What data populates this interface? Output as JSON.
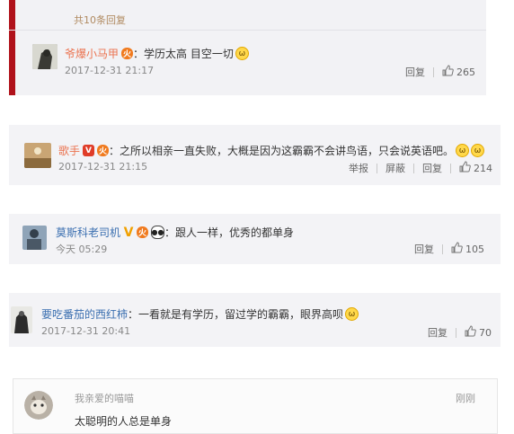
{
  "comments": [
    {
      "header": "共10条回复",
      "name": "爷爆小马甲",
      "text": "：学历太高 目空一切",
      "time": "2017-12-31 21:17",
      "reply": "回复",
      "likes": "265"
    },
    {
      "name": "歌手",
      "text": "：之所以相亲一直失败，大概是因为这霸霸不会讲鸟语，只会说英语吧。",
      "time": "2017-12-31 21:15",
      "report": "举报",
      "block": "屏蔽",
      "reply": "回复",
      "likes": "214"
    },
    {
      "name": "莫斯科老司机",
      "text": "：跟人一样，优秀的都单身",
      "time": "今天 05:29",
      "reply": "回复",
      "likes": "105"
    },
    {
      "name": "要吃番茄的西红柿",
      "text": "：一看就是有学历，留过学的霸霸，眼界高呗",
      "time": "2017-12-31 20:41",
      "reply": "回复",
      "likes": "70"
    },
    {
      "name": "我亲爱的喵喵",
      "time": "刚刚",
      "text": "太聪明的人总是单身"
    }
  ],
  "icons": {
    "thumb": "thumbs-up-icon",
    "laugh": "laughing-cat-emoji",
    "vip": "vip-badge-icon",
    "fire": "fire-badge-icon",
    "panda": "panda-badge-icon"
  },
  "colors": {
    "username": "#eb7350",
    "username_blue": "#3b6fb0",
    "accent_bar": "#b0121b"
  }
}
